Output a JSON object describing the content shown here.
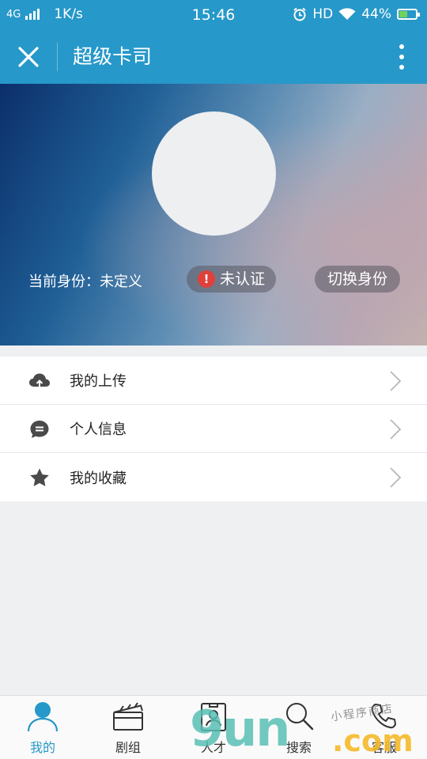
{
  "status_bar": {
    "network": "4G",
    "speed": "1K/s",
    "time": "15:46",
    "hd": "HD",
    "battery": "44%"
  },
  "nav": {
    "title": "超级卡司"
  },
  "profile": {
    "identity_label": "当前身份：未定义",
    "verify_label": "未认证",
    "switch_label": "切换身份"
  },
  "menu": {
    "items": [
      {
        "label": "我的上传",
        "icon": "cloud-upload-icon"
      },
      {
        "label": "个人信息",
        "icon": "message-icon"
      },
      {
        "label": "我的收藏",
        "icon": "star-icon"
      }
    ]
  },
  "tabs": [
    {
      "label": "我的",
      "icon": "person-icon",
      "active": true
    },
    {
      "label": "剧组",
      "icon": "clapperboard-icon",
      "active": false
    },
    {
      "label": "人才",
      "icon": "profile-card-icon",
      "active": false
    },
    {
      "label": "搜索",
      "icon": "search-icon",
      "active": false
    },
    {
      "label": "客服",
      "icon": "phone-icon",
      "active": false
    }
  ],
  "watermark": {
    "big": "9un",
    "com": ".com",
    "small": "小程序商店"
  },
  "colors": {
    "primary": "#2698c9",
    "warning": "#e0403a",
    "background": "#eff0f2"
  }
}
